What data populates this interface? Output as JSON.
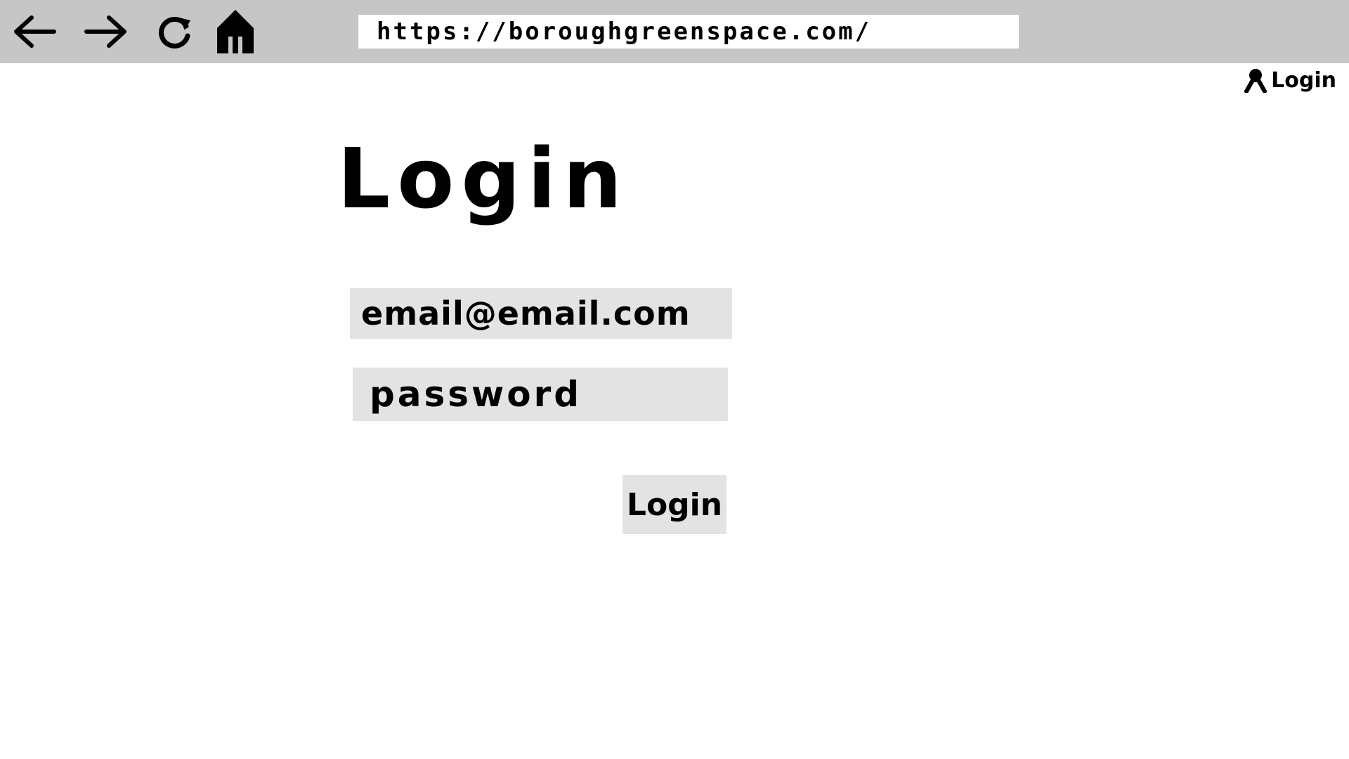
{
  "browser": {
    "back_icon": "arrow-left-icon",
    "forward_icon": "arrow-right-icon",
    "reload_icon": "reload-icon",
    "home_icon": "home-icon",
    "address": "https://boroughgreenspace.com/"
  },
  "header": {
    "login_icon": "user-icon",
    "login_label": "Login"
  },
  "main": {
    "title": "Login",
    "email_value": "email@email.com",
    "password_value": "password",
    "submit_label": "Login"
  },
  "colors": {
    "toolbar": "#c6c6c6",
    "field_background": "#e3e3e3",
    "page_background": "#ffffff"
  }
}
